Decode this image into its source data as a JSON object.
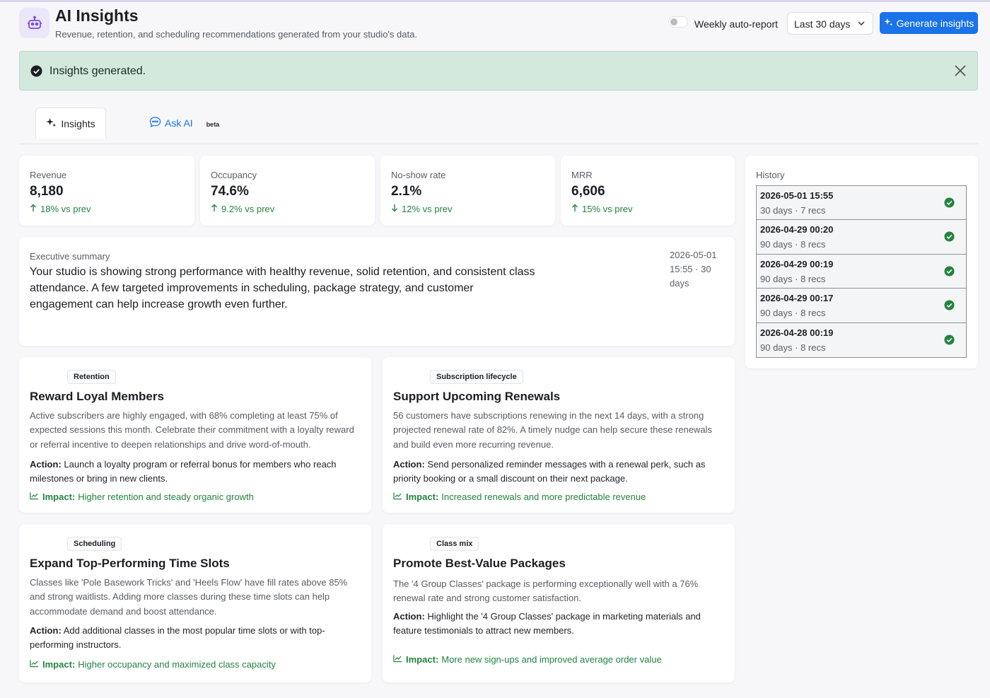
{
  "header": {
    "title": "AI Insights",
    "subtitle": "Revenue, retention, and scheduling recommendations generated from your studio's data.",
    "auto_report_label": "Weekly auto-report",
    "range_value": "Last 30 days",
    "generate_label": "Generate insights"
  },
  "alert": {
    "text": "Insights generated."
  },
  "tabs": {
    "insights": "Insights",
    "ask": "Ask AI",
    "beta": "beta"
  },
  "stats": [
    {
      "label": "Revenue",
      "value": "8,180",
      "delta": "18% vs prev",
      "direction": "up"
    },
    {
      "label": "Occupancy",
      "value": "74.6%",
      "delta": "9.2% vs prev",
      "direction": "up"
    },
    {
      "label": "No-show rate",
      "value": "2.1%",
      "delta": "12% vs prev",
      "direction": "down"
    },
    {
      "label": "MRR",
      "value": "6,606",
      "delta": "15% vs prev",
      "direction": "up"
    }
  ],
  "summary": {
    "label": "Executive summary",
    "text": "Your studio is showing strong performance with healthy revenue, solid retention, and consistent class attendance. A few targeted improvements in scheduling, package strategy, and customer engagement can help increase growth even further.",
    "meta": "2026-05-01 15:55 · 30 days"
  },
  "history": {
    "title": "History",
    "items": [
      {
        "date": "2026-05-01 15:55",
        "meta": "30 days · 7 recs"
      },
      {
        "date": "2026-04-29 00:20",
        "meta": "90 days · 8 recs"
      },
      {
        "date": "2026-04-29 00:19",
        "meta": "90 days · 8 recs"
      },
      {
        "date": "2026-04-29 00:17",
        "meta": "90 days · 8 recs"
      },
      {
        "date": "2026-04-28 00:19",
        "meta": "90 days · 8 recs"
      }
    ]
  },
  "insights": [
    {
      "tag": "Retention",
      "title": "Reward Loyal Members",
      "description": "Active subscribers are highly engaged, with 68% completing at least 75% of expected sessions this month. Celebrate their commitment with a loyalty reward or referral incentive to deepen relationships and drive word-of-mouth.",
      "action_label": "Action:",
      "action": "Launch a loyalty program or referral bonus for members who reach milestones or bring in new clients.",
      "impact_label": "Impact:",
      "impact": "Higher retention and steady organic growth"
    },
    {
      "tag": "Subscription lifecycle",
      "title": "Support Upcoming Renewals",
      "description": "56 customers have subscriptions renewing in the next 14 days, with a strong projected renewal rate of 82%. A timely nudge can help secure these renewals and build even more recurring revenue.",
      "action_label": "Action:",
      "action": "Send personalized reminder messages with a renewal perk, such as priority booking or a small discount on their next package.",
      "impact_label": "Impact:",
      "impact": "Increased renewals and more predictable revenue"
    },
    {
      "tag": "Scheduling",
      "title": "Expand Top-Performing Time Slots",
      "description": "Classes like 'Pole Basework Tricks' and 'Heels Flow' have fill rates above 85% and strong waitlists. Adding more classes during these time slots can help accommodate demand and boost attendance.",
      "action_label": "Action:",
      "action": "Add additional classes in the most popular time slots or with top-performing instructors.",
      "impact_label": "Impact:",
      "impact": "Higher occupancy and maximized class capacity"
    },
    {
      "tag": "Class mix",
      "title": "Promote Best-Value Packages",
      "description": "The '4 Group Classes' package is performing exceptionally well with a 76% renewal rate and strong customer satisfaction.",
      "action_label": "Action:",
      "action": "Highlight the '4 Group Classes' package in marketing materials and feature testimonials to attract new members.",
      "impact_label": "Impact:",
      "impact": "More new sign-ups and improved average order value"
    }
  ],
  "colors": {
    "accent": "#1a73e8",
    "success": "#23833f",
    "alert_bg": "#d3e9de",
    "brand_tint": "#ece6fb"
  }
}
